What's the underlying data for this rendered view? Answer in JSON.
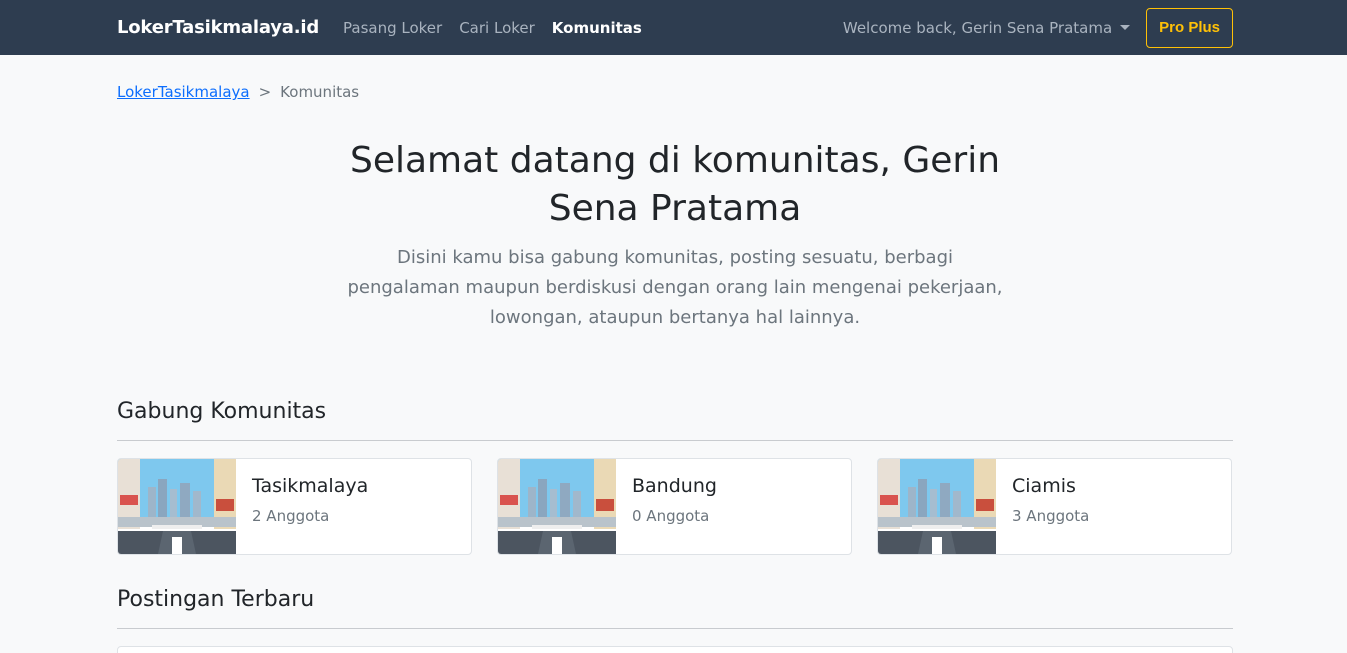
{
  "nav": {
    "brand": "LokerTasikmalaya.id",
    "links": [
      "Pasang Loker",
      "Cari Loker",
      "Komunitas"
    ],
    "active_link": "Komunitas",
    "welcome": "Welcome back, Gerin Sena Pratama",
    "pro_button": "Pro Plus"
  },
  "breadcrumb": {
    "home": "LokerTasikmalaya",
    "separator": ">",
    "current": "Komunitas"
  },
  "hero": {
    "title": "Selamat datang di komunitas, Gerin Sena Pratama",
    "description": "Disini kamu bisa gabung komunitas, posting sesuatu, berbagi pengalaman maupun berdiskusi dengan orang lain mengenai pekerjaan, lowongan, ataupun bertanya hal lainnya."
  },
  "communities": {
    "title": "Gabung Komunitas",
    "items": [
      {
        "name": "Tasikmalaya",
        "members": "2 Anggota"
      },
      {
        "name": "Bandung",
        "members": "0 Anggota"
      },
      {
        "name": "Ciamis",
        "members": "3 Anggota"
      }
    ]
  },
  "posts": {
    "title": "Postingan Terbaru"
  },
  "colors": {
    "navbar": "#2e3d50",
    "accent": "#ffc107",
    "link": "#0d6efd"
  }
}
